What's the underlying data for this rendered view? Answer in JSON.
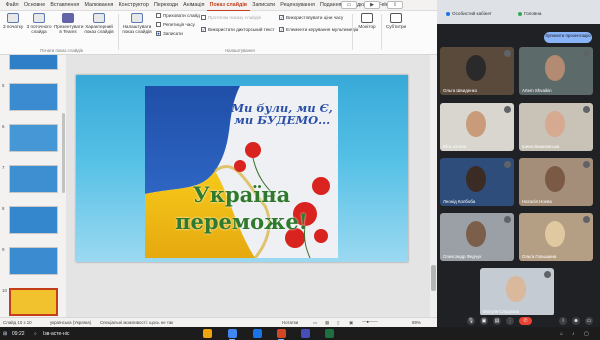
{
  "ppt": {
    "tabs": [
      {
        "label": "Файл"
      },
      {
        "label": "Основне"
      },
      {
        "label": "Вставлення"
      },
      {
        "label": "Малювання"
      },
      {
        "label": "Конструктор"
      },
      {
        "label": "Переходи"
      },
      {
        "label": "Анімація"
      },
      {
        "label": "Показ слайдів",
        "active": true
      },
      {
        "label": "Записати"
      },
      {
        "label": "Рецензування"
      },
      {
        "label": "Подання"
      },
      {
        "label": "Довідка"
      },
      {
        "label": "PDFelement"
      }
    ],
    "ribbon": {
      "btn_from_start": "З початку",
      "btn_from_current": "З поточного слайда",
      "btn_present_teams": "Презентувати в Teams",
      "btn_custom_show": "Характерний показ слайдів",
      "btn_setup": "Налаштувати показ слайдів",
      "chk_hide": "Приховати слайд",
      "chk_rehearse": "Репетиція часу",
      "btn_record": "Записати",
      "chk_play_narr": "Протягом показу слайдів",
      "chk_use_timings": "Використати дикторський текст",
      "chk_use_narrations": "Використовувати ціни часу",
      "chk_media": "Елементи керування мультимедіа",
      "chk_record_narr": "Використовувати ціни часу",
      "btn_monitor": "Монітор",
      "btn_subtitles": "Субтитри",
      "group_start": "Почати показ слайдів",
      "group_setup": "Налаштування"
    },
    "thumbs": [
      {
        "num": "4",
        "color": "#2e7fc8"
      },
      {
        "num": "5",
        "color": "#3a8bd0"
      },
      {
        "num": "6",
        "color": "#4597d6"
      },
      {
        "num": "7",
        "color": "#3e8fd2"
      },
      {
        "num": "8",
        "color": "#3487cc"
      },
      {
        "num": "9",
        "color": "#3a8bd0"
      },
      {
        "num": "10",
        "color": "#f2c12e"
      }
    ],
    "slide": {
      "title": "Ми були, ми Є, ми БУДЕМО...",
      "main_line1": "Україна",
      "main_line2": "переможе!"
    },
    "status": {
      "slide_info": "Слайд 10 з 10",
      "lang": "українська (Україна)",
      "accessibility": "Спеціальні можливості: щось не так",
      "notes": "Нотатки",
      "zoom": "89%"
    }
  },
  "meet": {
    "browser_tabs": [
      {
        "label": "Особистий кабінет",
        "color": "#1a73e8"
      },
      {
        "label": "Головна",
        "color": "#34a853"
      }
    ],
    "join_label": "Зупинити презентацію",
    "participants": [
      {
        "name": "Ольга Швиденко",
        "bg": "#5a4a3c",
        "avatar": "#2a2a2a"
      },
      {
        "name": "Artem Shvaikin",
        "bg": "#5d6a6a",
        "avatar": "#b38a72"
      },
      {
        "name": "Віта vorona",
        "bg": "#d9d6cf",
        "avatar": "#c99b7b"
      },
      {
        "name": "Ірина Вишневська",
        "bg": "#c9c2b6",
        "avatar": "#d6a991"
      },
      {
        "name": "Леонід Колбоба",
        "bg": "#2f4d7a",
        "avatar": "#3b2b25"
      },
      {
        "name": "Наталія Ноева",
        "bg": "#a58e79",
        "avatar": "#7a5a45"
      },
      {
        "name": "Олександр Федчук",
        "bg": "#9aa0a6",
        "avatar": "#7c5f4b"
      },
      {
        "name": "Ольга Голышина",
        "bg": "#b49f85",
        "avatar": "#e0c8a0"
      },
      {
        "name": "Мотуля Слуцкова",
        "bg": "#c4cbd2",
        "avatar": "#d9b89b"
      }
    ]
  },
  "taskbar": {
    "time": "09:22",
    "search": "Ізв-асте-ніс"
  }
}
